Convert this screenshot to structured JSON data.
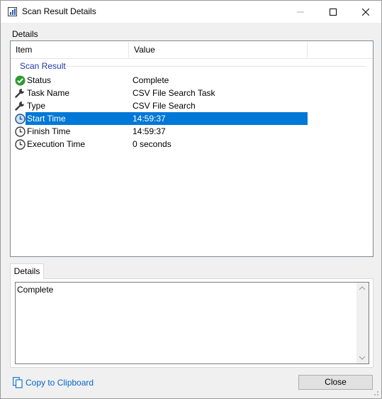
{
  "window": {
    "title": "Scan Result Details"
  },
  "group_label": "Details",
  "list": {
    "columns": [
      "Item",
      "Value"
    ],
    "group_header": "Scan Result",
    "rows": [
      {
        "item": "Status",
        "value": "Complete",
        "icon": "check-circle-icon"
      },
      {
        "item": "Task Name",
        "value": "CSV File Search Task",
        "icon": "wrench-icon"
      },
      {
        "item": "Type",
        "value": "CSV File Search",
        "icon": "wrench-icon"
      },
      {
        "item": "Start Time",
        "value": "14:59:37",
        "icon": "clock-icon",
        "selected": true
      },
      {
        "item": "Finish Time",
        "value": "14:59:37",
        "icon": "clock-icon"
      },
      {
        "item": "Execution Time",
        "value": "0 seconds",
        "icon": "clock-icon"
      }
    ]
  },
  "details_tab": {
    "label": "Details",
    "text": "Complete"
  },
  "footer": {
    "copy_label": "Copy to Clipboard",
    "close_label": "Close"
  },
  "colors": {
    "selection": "#0078d7",
    "group_header": "#1e3aa8",
    "link": "#0066cc",
    "status_ok": "#2e9a2e"
  }
}
